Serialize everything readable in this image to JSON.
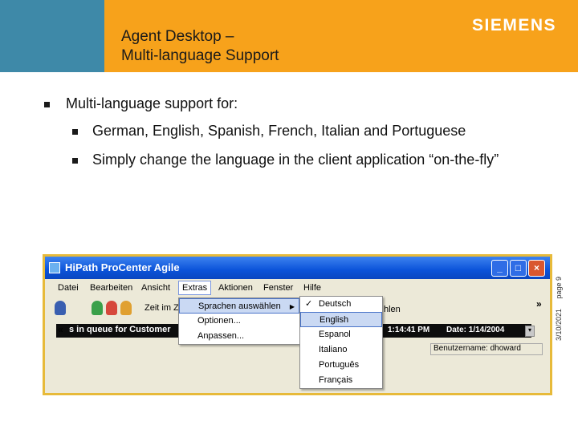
{
  "slide": {
    "title_line1": "Agent Desktop –",
    "title_line2": "Multi-language Support",
    "logo": "SIEMENS",
    "bullet_main": "Multi-language support for:",
    "bullet_sub1": "German, English, Spanish, French, Italian and Portuguese",
    "bullet_sub2": "Simply change the language in the client application “on-the-fly”",
    "footer_date": "3/10/2021",
    "footer_page": "page 9"
  },
  "colors": {
    "header_orange": "#f7a21b",
    "header_teal": "#3e89a8",
    "frame_gold": "#e7ba3a",
    "titlebar_blue": "#0b53d9"
  },
  "app": {
    "title": "HiPath ProCenter Agile",
    "menu": [
      "Datei",
      "Bearbeiten",
      "Ansicht",
      "Extras",
      "Aktionen",
      "Fenster",
      "Hilfe"
    ],
    "toolbar_text": "Zeit im Z",
    "toolbar_text2": "hlen",
    "queue_text": "s in queue for Customer",
    "queue_time": "1:14:41 PM",
    "queue_date": "Date:  1/14/2004",
    "status_user": "Benutzername: dhoward",
    "extras_menu": [
      "Sprachen auswählen",
      "Optionen...",
      "Anpassen..."
    ],
    "languages": [
      "Deutsch",
      "English",
      "Espanol",
      "Italiano",
      "Português",
      "Français"
    ],
    "selected_language": "English",
    "checked_language": "Deutsch"
  }
}
